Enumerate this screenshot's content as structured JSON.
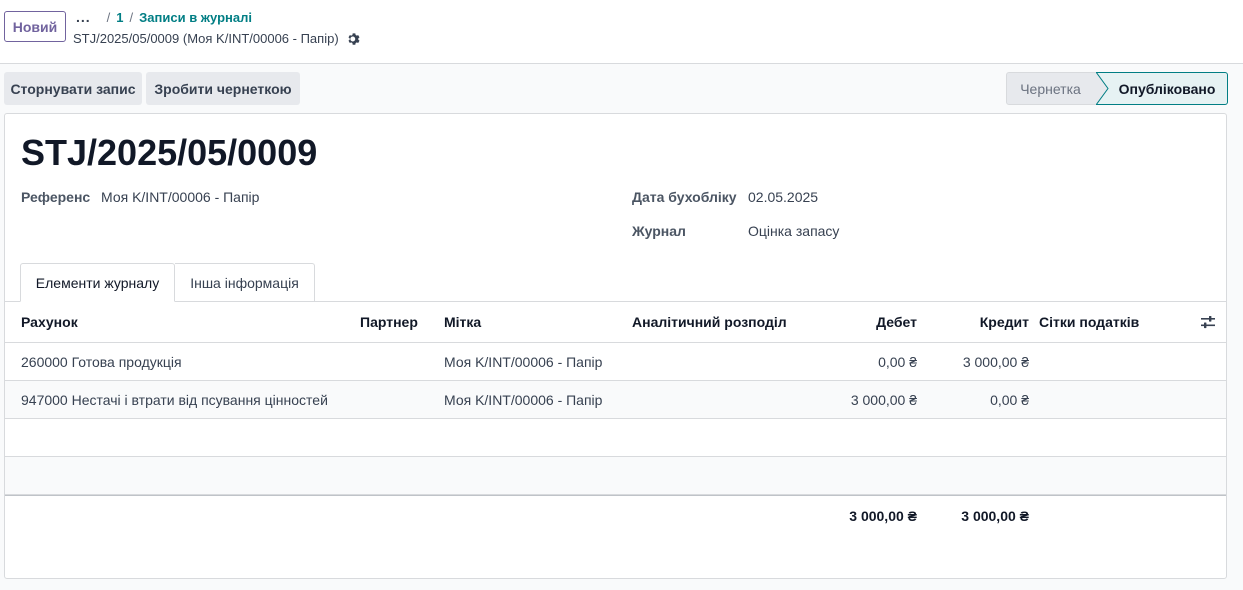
{
  "topbar": {
    "new_label": "Новий",
    "breadcrumb_ellipsis": "...",
    "breadcrumb_separator": "/",
    "breadcrumb_page": "1",
    "breadcrumb_link": "Записи в журналі",
    "record_title": "STJ/2025/05/0009 (Моя K/INT/00006 - Папір)"
  },
  "actions": {
    "reverse_label": "Сторнувати запис",
    "draft_label": "Зробити чернеткою"
  },
  "status": {
    "draft": "Чернетка",
    "posted": "Опубліковано",
    "current": "posted"
  },
  "record": {
    "name": "STJ/2025/05/0009",
    "reference_label": "Референс",
    "reference_value": "Моя K/INT/00006 - Папір",
    "date_label": "Дата бухобліку",
    "date_value": "02.05.2025",
    "journal_label": "Журнал",
    "journal_value": "Оцінка запасу"
  },
  "tabs": [
    {
      "label": "Елементи журналу",
      "active": true
    },
    {
      "label": "Інша інформація",
      "active": false
    }
  ],
  "grid": {
    "columns": {
      "account": "Рахунок",
      "partner": "Партнер",
      "label": "Мітка",
      "analytic": "Аналітичний розподіл",
      "debit": "Дебет",
      "credit": "Кредит",
      "tax_grids": "Сітки податків"
    },
    "rows": [
      {
        "account": "260000 Готова продукція",
        "partner": "",
        "label": "Моя K/INT/00006 - Папір",
        "analytic": "",
        "debit": "0,00 ₴",
        "credit": "3 000,00 ₴",
        "tax_grids": ""
      },
      {
        "account": "947000 Нестачі і втрати від псування цінностей",
        "partner": "",
        "label": "Моя K/INT/00006 - Папір",
        "analytic": "",
        "debit": "3 000,00 ₴",
        "credit": "0,00 ₴",
        "tax_grids": ""
      }
    ],
    "total_debit": "3 000,00 ₴",
    "total_credit": "3 000,00 ₴"
  },
  "icons": {
    "gear": "gear-icon",
    "optional_columns": "sliders-icon"
  },
  "colors": {
    "accent": "#017e84",
    "primary": "#71639e"
  }
}
